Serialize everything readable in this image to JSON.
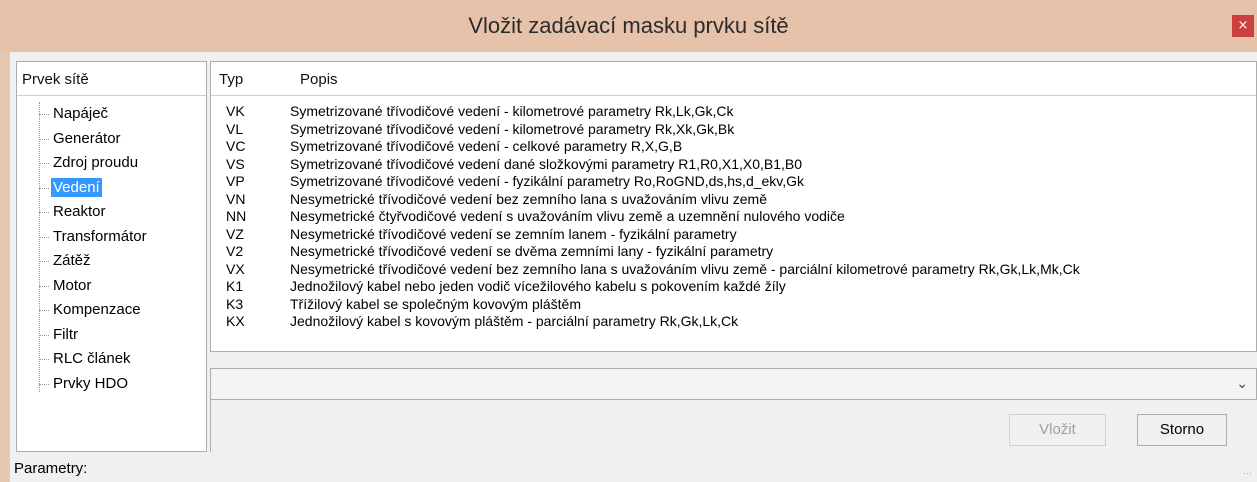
{
  "window": {
    "title": "Vložit zadávací masku prvku sítě",
    "close_glyph": "×"
  },
  "left_pane": {
    "header": "Prvek sítě",
    "items": [
      {
        "label": "Napáječ"
      },
      {
        "label": "Generátor"
      },
      {
        "label": "Zdroj proudu"
      },
      {
        "label": "Vedení",
        "selected": true
      },
      {
        "label": "Reaktor"
      },
      {
        "label": "Transformátor"
      },
      {
        "label": "Zátěž"
      },
      {
        "label": "Motor"
      },
      {
        "label": "Kompenzace"
      },
      {
        "label": "Filtr"
      },
      {
        "label": "RLC článek"
      },
      {
        "label": "Prvky HDO"
      }
    ]
  },
  "table": {
    "columns": [
      "Typ",
      "Popis"
    ],
    "rows": [
      {
        "code": "VK",
        "desc": "Symetrizované třívodičové vedení - kilometrové parametry Rk,Lk,Gk,Ck"
      },
      {
        "code": "VL",
        "desc": "Symetrizované třívodičové vedení - kilometrové parametry Rk,Xk,Gk,Bk"
      },
      {
        "code": "VC",
        "desc": "Symetrizované třívodičové vedení - celkové parametry R,X,G,B"
      },
      {
        "code": "VS",
        "desc": "Symetrizované třívodičové vedení dané složkovými parametry R1,R0,X1,X0,B1,B0"
      },
      {
        "code": "VP",
        "desc": "Symetrizované třívodičové vedení - fyzikální parametry Ro,RoGND,ds,hs,d_ekv,Gk"
      },
      {
        "code": "VN",
        "desc": "Nesymetrické třívodičové vedení bez zemního lana s uvažováním vlivu země"
      },
      {
        "code": "NN",
        "desc": "Nesymetrické čtyřvodičové vedení s uvažováním vlivu země a uzemnění nulového vodiče"
      },
      {
        "code": "VZ",
        "desc": "Nesymetrické třívodičové vedení se zemním lanem - fyzikální parametry"
      },
      {
        "code": "V2",
        "desc": "Nesymetrické třívodičové vedení se dvěma zemními lany - fyzikální parametry"
      },
      {
        "code": "VX",
        "desc": "Nesymetrické třívodičové vedení bez zemního lana s uvažováním vlivu země - parciální kilometrové parametry Rk,Gk,Lk,Mk,Ck"
      },
      {
        "code": "K1",
        "desc": "Jednožilový kabel nebo jeden vodič vícežilového kabelu s pokovením každé žíly"
      },
      {
        "code": "K3",
        "desc": "Třížilový kabel se společným kovovým pláštěm"
      },
      {
        "code": "KX",
        "desc": "Jednožilový kabel s kovovým pláštěm - parciální parametry Rk,Gk,Lk,Ck"
      }
    ]
  },
  "dropdown": {
    "value": "",
    "arrow_icon": "chevron-down-icon"
  },
  "buttons": {
    "insert": "Vložit",
    "cancel": "Storno",
    "insert_disabled": true
  },
  "status": {
    "label": "Parametry:"
  },
  "colors": {
    "titlebar": "#e6c2ab",
    "close": "#c9403c",
    "selection": "#3399ff"
  }
}
